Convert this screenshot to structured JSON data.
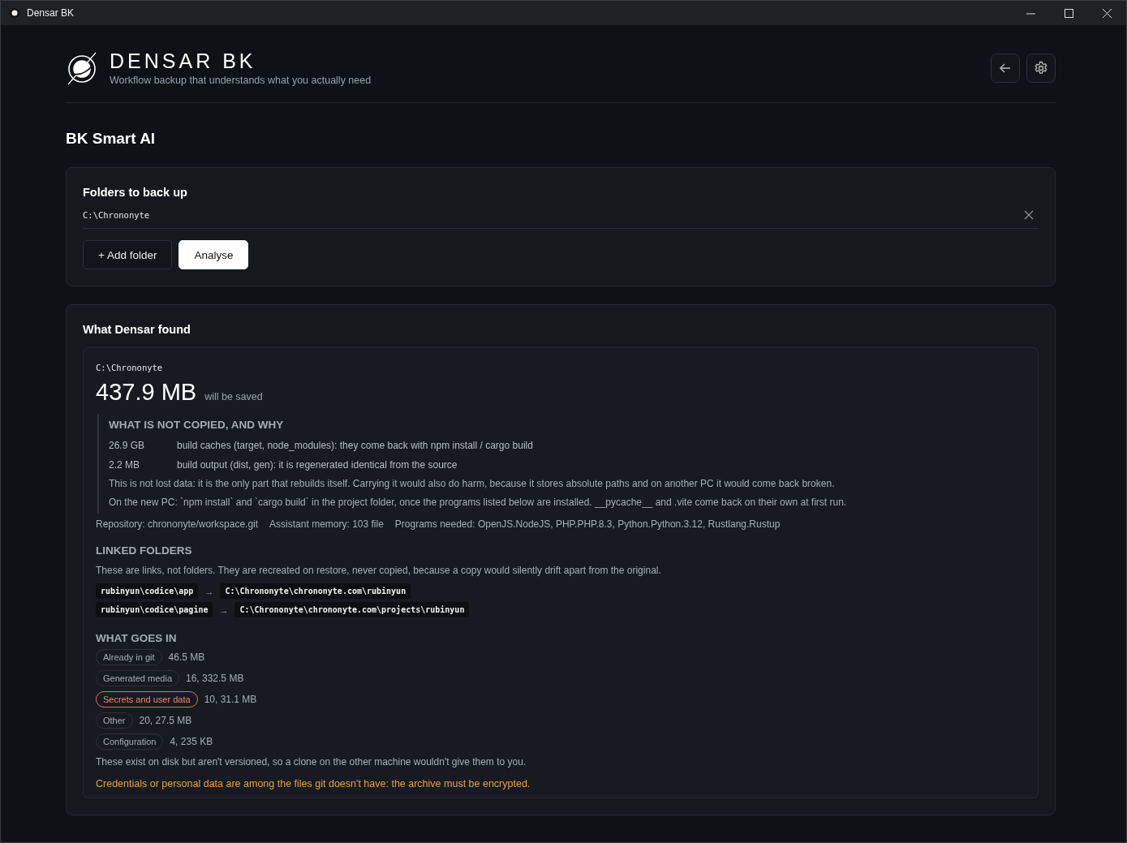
{
  "window": {
    "title": "Densar BK"
  },
  "header": {
    "brand": "DENSAR BK",
    "tagline": "Workflow backup that understands what you actually need"
  },
  "page_title": "BK Smart AI",
  "folders_card": {
    "title": "Folders to back up",
    "folders": [
      {
        "path": "C:\\Chrononyte"
      }
    ],
    "buttons": [
      {
        "label": "+ Add folder",
        "kind": "secondary"
      },
      {
        "label": "Analyse",
        "kind": "primary"
      }
    ]
  },
  "results": {
    "title": "What Densar found",
    "folders": [
      {
        "path": "C:\\Chrononyte",
        "size": "437.9 MB",
        "size_note": "will be saved",
        "excluded": {
          "title": "WHAT IS NOT COPIED, AND WHY",
          "rows": [
            {
              "size": "26.9 GB",
              "reason": "build caches (target, node_modules): they come back with npm install / cargo build"
            },
            {
              "size": "2.2 MB",
              "reason": "build output (dist, gen): it is regenerated identical from the source"
            }
          ],
          "notes": [
            "This is not lost data: it is the only part that rebuilds itself. Carrying it would also do harm, because it stores absolute paths and on another PC it would come back broken.",
            "On the new PC: `npm install` and `cargo build` in the project folder, once the programs listed below are installed. __pycache__ and .vite come back on their own at first run."
          ]
        },
        "meta": [
          "Repository: chrononyte/workspace.git",
          "Assistant memory: 103 file",
          "Programs needed: OpenJS.NodeJS, PHP.PHP.8.3, Python.Python.3.12, Rustlang.Rustup"
        ],
        "linked": {
          "title": "LINKED FOLDERS",
          "description": "These are links, not folders. They are recreated on restore, never copied, because a copy would silently drift apart from the original.",
          "links": [
            {
              "source": "rubinyun\\codice\\app",
              "arrow": "→",
              "target": "C:\\Chrononyte\\chrononyte.com\\rubinyun"
            },
            {
              "source": "rubinyun\\codice\\pagine",
              "arrow": "→",
              "target": "C:\\Chrononyte\\chrononyte.com\\projects\\rubinyun"
            }
          ]
        },
        "included": {
          "title": "WHAT GOES IN",
          "categories": [
            {
              "label": "Already in git",
              "count": "46.5 MB",
              "flagged": false
            },
            {
              "label": "Generated media",
              "count": "16, 332.5 MB",
              "flagged": false
            },
            {
              "label": "Secrets and user data",
              "count": "10, 31.1 MB",
              "flagged": true
            },
            {
              "label": "Other",
              "count": "20, 27.5 MB",
              "flagged": false
            },
            {
              "label": "Configuration",
              "count": "4, 235 KB",
              "flagged": false
            }
          ],
          "note": "These exist on disk but aren't versioned, so a clone on the other machine wouldn't give them to you.",
          "warning": "Credentials or personal data are among the files git doesn't have: the archive must be encrypted."
        }
      }
    ]
  }
}
